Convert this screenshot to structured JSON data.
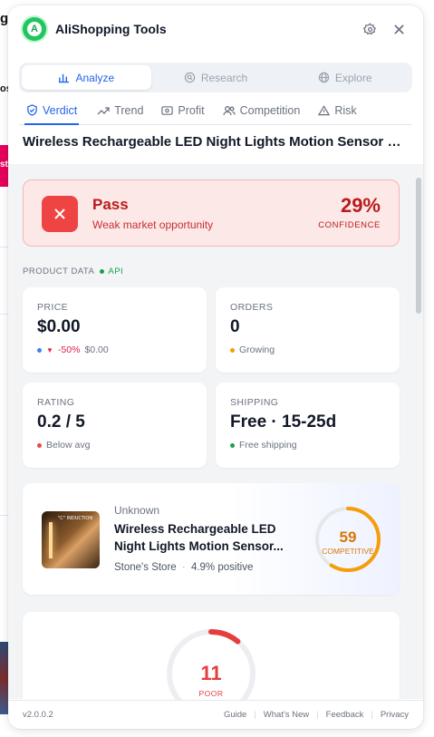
{
  "background": {
    "frag_top": "g",
    "frag_os": "os",
    "frag_st": "st"
  },
  "header": {
    "title": "AliShopping Tools",
    "logo_letter": "A"
  },
  "modes": [
    {
      "label": "Analyze",
      "active": true
    },
    {
      "label": "Research",
      "active": false
    },
    {
      "label": "Explore",
      "active": false
    }
  ],
  "tabs": [
    {
      "label": "Verdict",
      "active": true
    },
    {
      "label": "Trend",
      "active": false
    },
    {
      "label": "Profit",
      "active": false
    },
    {
      "label": "Competition",
      "active": false
    },
    {
      "label": "Risk",
      "active": false
    }
  ],
  "product_title": "Wireless Rechargeable LED Night Lights Motion Sensor Lig...",
  "verdict": {
    "label": "Pass",
    "subtitle": "Weak market opportunity",
    "confidence_value": "29%",
    "confidence_label": "CONFIDENCE"
  },
  "product_data": {
    "section_label": "PRODUCT DATA",
    "source_badge": "API",
    "price": {
      "label": "PRICE",
      "value": "$0.00",
      "change": "-50%",
      "previous": "$0.00"
    },
    "orders": {
      "label": "ORDERS",
      "value": "0",
      "status": "Growing"
    },
    "rating": {
      "label": "RATING",
      "value": "0.2 / 5",
      "status": "Below avg"
    },
    "shipping": {
      "label": "SHIPPING",
      "value": "Free · 15-25d",
      "status": "Free shipping"
    }
  },
  "product_card": {
    "category": "Unknown",
    "name_line1": "Wireless Rechargeable LED",
    "name_line2": "Night Lights Motion Sensor...",
    "store": "Stone's Store",
    "positive": "4.9% positive",
    "image_caption": "\"C\" INDUCTION",
    "competition_score": "59",
    "competition_label": "COMPETITIVE",
    "competition_fraction": 0.59
  },
  "score": {
    "value": "11",
    "label": "POOR",
    "fraction": 0.11
  },
  "footer": {
    "version": "v2.0.0.2",
    "links": [
      "Guide",
      "What's New",
      "Feedback",
      "Privacy"
    ]
  },
  "colors": {
    "accent": "#2563eb",
    "pass_red": "#ef4444",
    "competitive_orange": "#f59e0b",
    "poor_red": "#e53e3e",
    "api_green": "#16a34a"
  }
}
